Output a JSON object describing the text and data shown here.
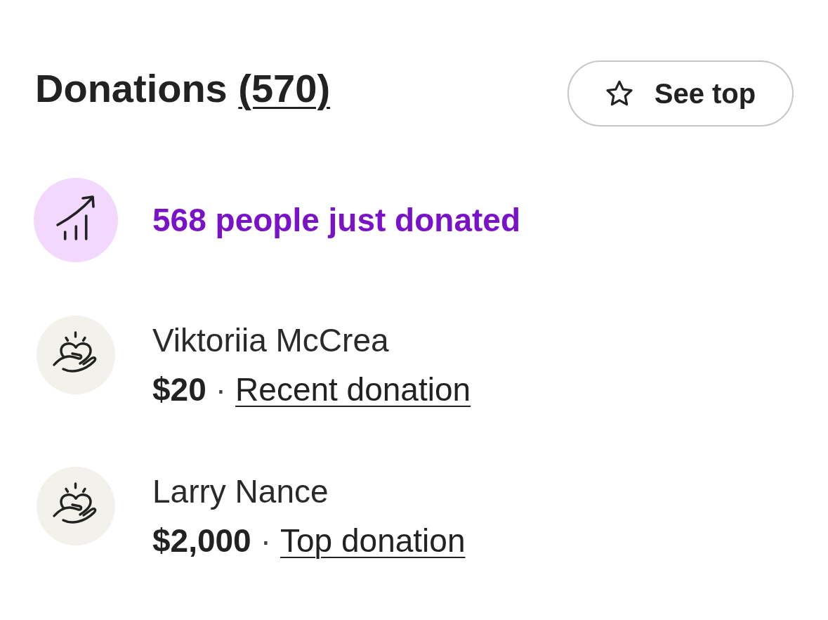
{
  "header": {
    "title": "Donations",
    "count": "(570)",
    "see_top_button": {
      "label": "See top"
    }
  },
  "activity": {
    "text": "568 people just donated"
  },
  "donations": [
    {
      "name": "Viktoriia McCrea",
      "amount": "$20",
      "separator": "·",
      "tag": "Recent donation"
    },
    {
      "name": "Larry Nance",
      "amount": "$2,000",
      "separator": "·",
      "tag": "Top donation"
    }
  ]
}
